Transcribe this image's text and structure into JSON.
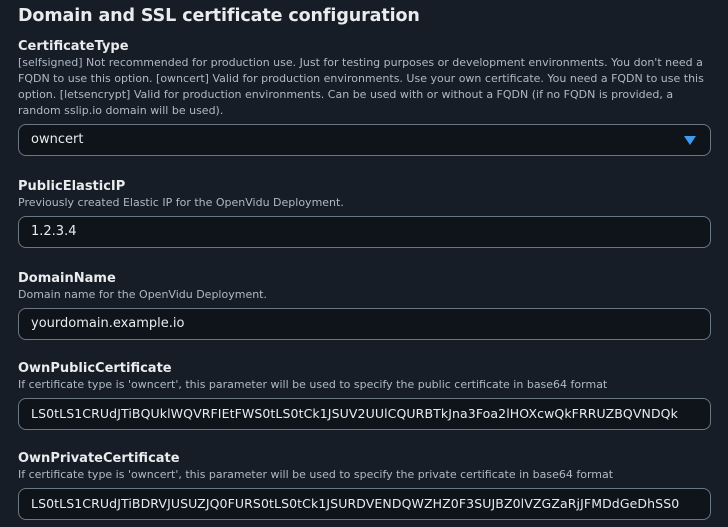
{
  "section": {
    "title": "Domain and SSL certificate configuration"
  },
  "fields": {
    "certificate_type": {
      "label": "CertificateType",
      "description": "[selfsigned] Not recommended for production use. Just for testing purposes or development environments. You don't need a FQDN to use this option. [owncert] Valid for production environments. Use your own certificate. You need a FQDN to use this option. [letsencrypt] Valid for production environments. Can be used with or without a FQDN (if no FQDN is provided, a random sslip.io domain will be used).",
      "value": "owncert"
    },
    "public_elastic_ip": {
      "label": "PublicElasticIP",
      "description": "Previously created Elastic IP for the OpenVidu Deployment.",
      "value": "1.2.3.4"
    },
    "domain_name": {
      "label": "DomainName",
      "description": "Domain name for the OpenVidu Deployment.",
      "value": "yourdomain.example.io"
    },
    "own_public_certificate": {
      "label": "OwnPublicCertificate",
      "description": "If certificate type is 'owncert', this parameter will be used to specify the public certificate in base64 format",
      "value": "LS0tLS1CRUdJTiBQUklWQVRFIEtFWS0tLS0tCk1JSUV2UUlCQURBTkJna3Foa2lHOXcwQkFRRUZBQVNDQk"
    },
    "own_private_certificate": {
      "label": "OwnPrivateCertificate",
      "description": "If certificate type is 'owncert', this parameter will be used to specify the private certificate in base64 format",
      "value": "LS0tLS1CRUdJTiBDRVJUSUZJQ0FURS0tLS0tCk1JSURDVENDQWZHZ0F3SUJBZ0lVZGZaRjJFMDdGeDhSS0"
    }
  },
  "icons": {
    "select_caret": "caret-down-icon"
  },
  "colors": {
    "accent": "#3d9cf0",
    "background": "#161d26",
    "input_background": "#0f141a"
  }
}
